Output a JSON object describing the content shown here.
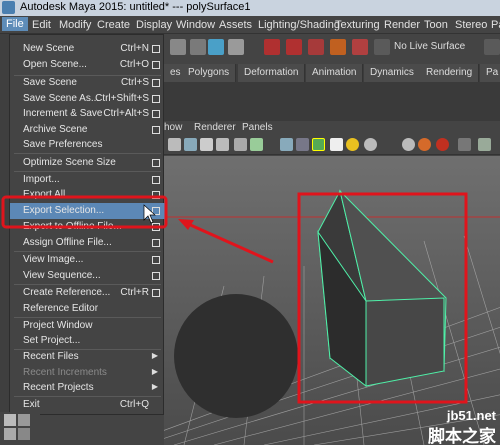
{
  "window": {
    "title": "Autodesk Maya 2015: untitled*   ---   polySurface1"
  },
  "menubar": [
    "File",
    "Edit",
    "Modify",
    "Create",
    "Display",
    "Window",
    "Assets",
    "Lighting/Shading",
    "Texturing",
    "Render",
    "Toon",
    "Stereo",
    "Pa"
  ],
  "toolbar": {
    "live_surface": "No Live Surface"
  },
  "shelf_tabs": [
    "es",
    "Polygons",
    "Deformation",
    "Animation",
    "Dynamics",
    "Rendering",
    "Pa"
  ],
  "panel_menu": [
    "how",
    "Renderer",
    "Panels"
  ],
  "file_menu": [
    {
      "label": "New Scene",
      "shortcut": "Ctrl+N",
      "option": true
    },
    {
      "label": "Open Scene...",
      "shortcut": "Ctrl+O",
      "option": true
    },
    {
      "label": "Save Scene",
      "shortcut": "Ctrl+S",
      "option": true
    },
    {
      "label": "Save Scene As...",
      "shortcut": "Ctrl+Shift+S",
      "option": true
    },
    {
      "label": "Increment & Save",
      "shortcut": "Ctrl+Alt+S",
      "option": true
    },
    {
      "label": "Archive Scene",
      "shortcut": "",
      "option": true
    },
    {
      "label": "Save Preferences",
      "shortcut": "",
      "option": false
    },
    {
      "label": "Optimize Scene Size",
      "shortcut": "",
      "option": true
    },
    {
      "label": "Import...",
      "shortcut": "",
      "option": true
    },
    {
      "label": "Export All...",
      "shortcut": "",
      "option": true
    },
    {
      "label": "Export Selection...",
      "shortcut": "",
      "option": true,
      "highlighted": true
    },
    {
      "label": "Export to Offline File...",
      "shortcut": "",
      "option": true
    },
    {
      "label": "Assign Offline File...",
      "shortcut": "",
      "option": true
    },
    {
      "label": "View Image...",
      "shortcut": "",
      "option": true
    },
    {
      "label": "View Sequence...",
      "shortcut": "",
      "option": true
    },
    {
      "label": "Create Reference...",
      "shortcut": "Ctrl+R",
      "option": true
    },
    {
      "label": "Reference Editor",
      "shortcut": "",
      "option": false
    },
    {
      "label": "Project Window",
      "shortcut": "",
      "option": false
    },
    {
      "label": "Set Project...",
      "shortcut": "",
      "option": false
    },
    {
      "label": "Recent Files",
      "shortcut": "",
      "option": false,
      "submenu": true
    },
    {
      "label": "Recent Increments",
      "shortcut": "",
      "option": false,
      "submenu": true,
      "disabled": true
    },
    {
      "label": "Recent Projects",
      "shortcut": "",
      "option": false,
      "submenu": true
    },
    {
      "label": "Exit",
      "shortcut": "Ctrl+Q",
      "option": false
    }
  ],
  "watermark": {
    "site": "jb51.net",
    "cn": "脚本之家"
  },
  "colors": {
    "highlight": "#5c88b6",
    "annotation": "#e0141c",
    "wireframe": "#4ff0a8"
  },
  "icons": [
    "maya-logo-icon",
    "option-box-icon",
    "submenu-arrow-icon",
    "mouse-cursor-icon"
  ]
}
